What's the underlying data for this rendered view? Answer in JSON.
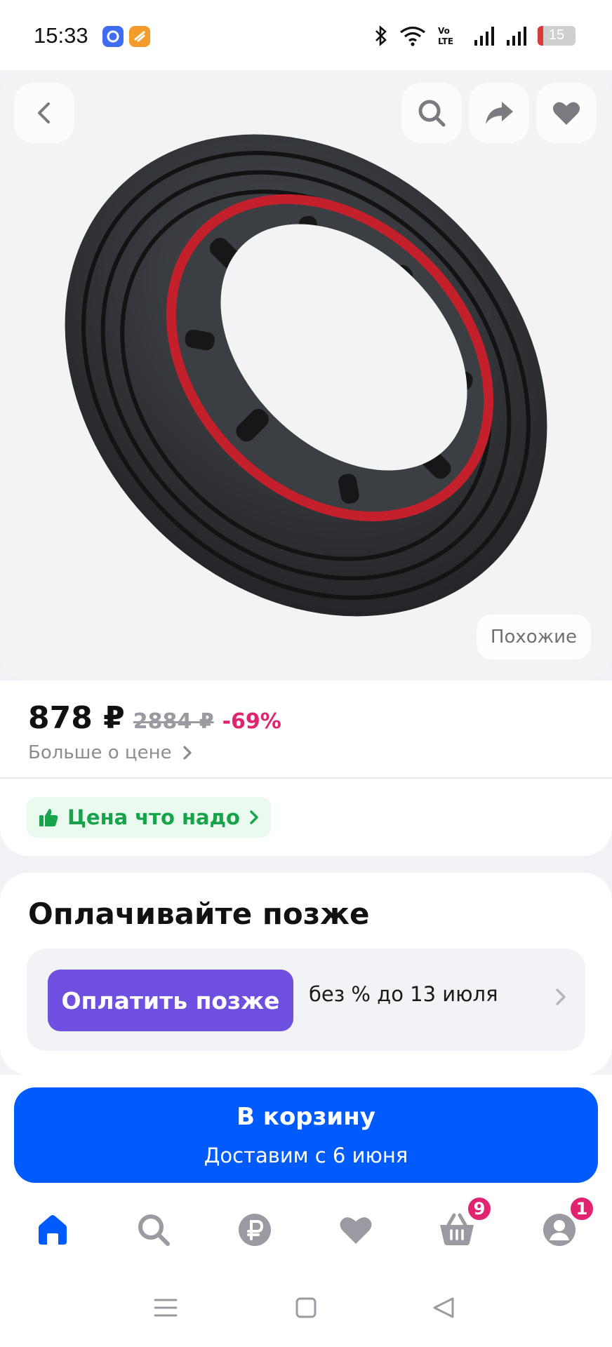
{
  "status_bar": {
    "time": "15:33",
    "battery_level": "15",
    "battery_fraction": 0.15,
    "icons": [
      "bluetooth-icon",
      "wifi-icon",
      "volte-icon",
      "signal-icon",
      "signal-icon",
      "battery-icon"
    ]
  },
  "product_image": {
    "similar_label": "Похожие"
  },
  "price": {
    "current": "878 ₽",
    "old": "2884 ₽",
    "discount": "-69%",
    "more_link": "Больше о цене"
  },
  "good_price_badge": {
    "label": "Цена что надо"
  },
  "pay_later": {
    "title": "Оплачивайте позже",
    "button_label": "Оплатить позже",
    "terms": "без % до 13 июля"
  },
  "cart": {
    "label": "В корзину",
    "delivery": "Доставим с 6 июня"
  },
  "bottom_nav": {
    "items": [
      {
        "icon": "home-icon",
        "active": true
      },
      {
        "icon": "search-icon"
      },
      {
        "icon": "ruble-icon"
      },
      {
        "icon": "heart-icon"
      },
      {
        "icon": "basket-icon",
        "badge": "9"
      },
      {
        "icon": "profile-icon",
        "badge": "1"
      }
    ]
  },
  "colors": {
    "accent": "#005bff",
    "pay_later": "#6e4fe0",
    "discount": "#e0246f",
    "good_price": "#16a34a",
    "tire_red": "#c3202b"
  }
}
